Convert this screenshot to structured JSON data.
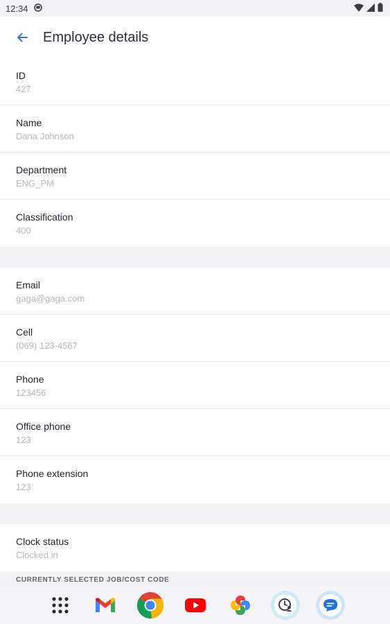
{
  "status_bar": {
    "time": "12:34"
  },
  "header": {
    "title": "Employee details",
    "back_icon": "arrow-back-icon",
    "accent": "#3b6fe0"
  },
  "fields_group1": [
    {
      "label": "ID",
      "value": "427"
    },
    {
      "label": "Name",
      "value": "Dana Johnson"
    },
    {
      "label": "Department",
      "value": "ENG_PM"
    },
    {
      "label": "Classification",
      "value": "400"
    }
  ],
  "fields_group2": [
    {
      "label": "Email",
      "value": "gaga@gaga.com"
    },
    {
      "label": "Cell",
      "value": "(069) 123-4567"
    },
    {
      "label": "Phone",
      "value": "123456"
    },
    {
      "label": "Office phone",
      "value": "123"
    },
    {
      "label": "Phone extension",
      "value": "123"
    }
  ],
  "fields_group3": [
    {
      "label": "Clock status",
      "value": "Clocked in"
    }
  ],
  "section_header": "CURRENTLY SELECTED JOB/COST CODE",
  "dock": [
    "apps-grid-icon",
    "gmail-icon",
    "chrome-icon",
    "youtube-icon",
    "photos-icon",
    "clock-person-icon",
    "messages-icon"
  ]
}
